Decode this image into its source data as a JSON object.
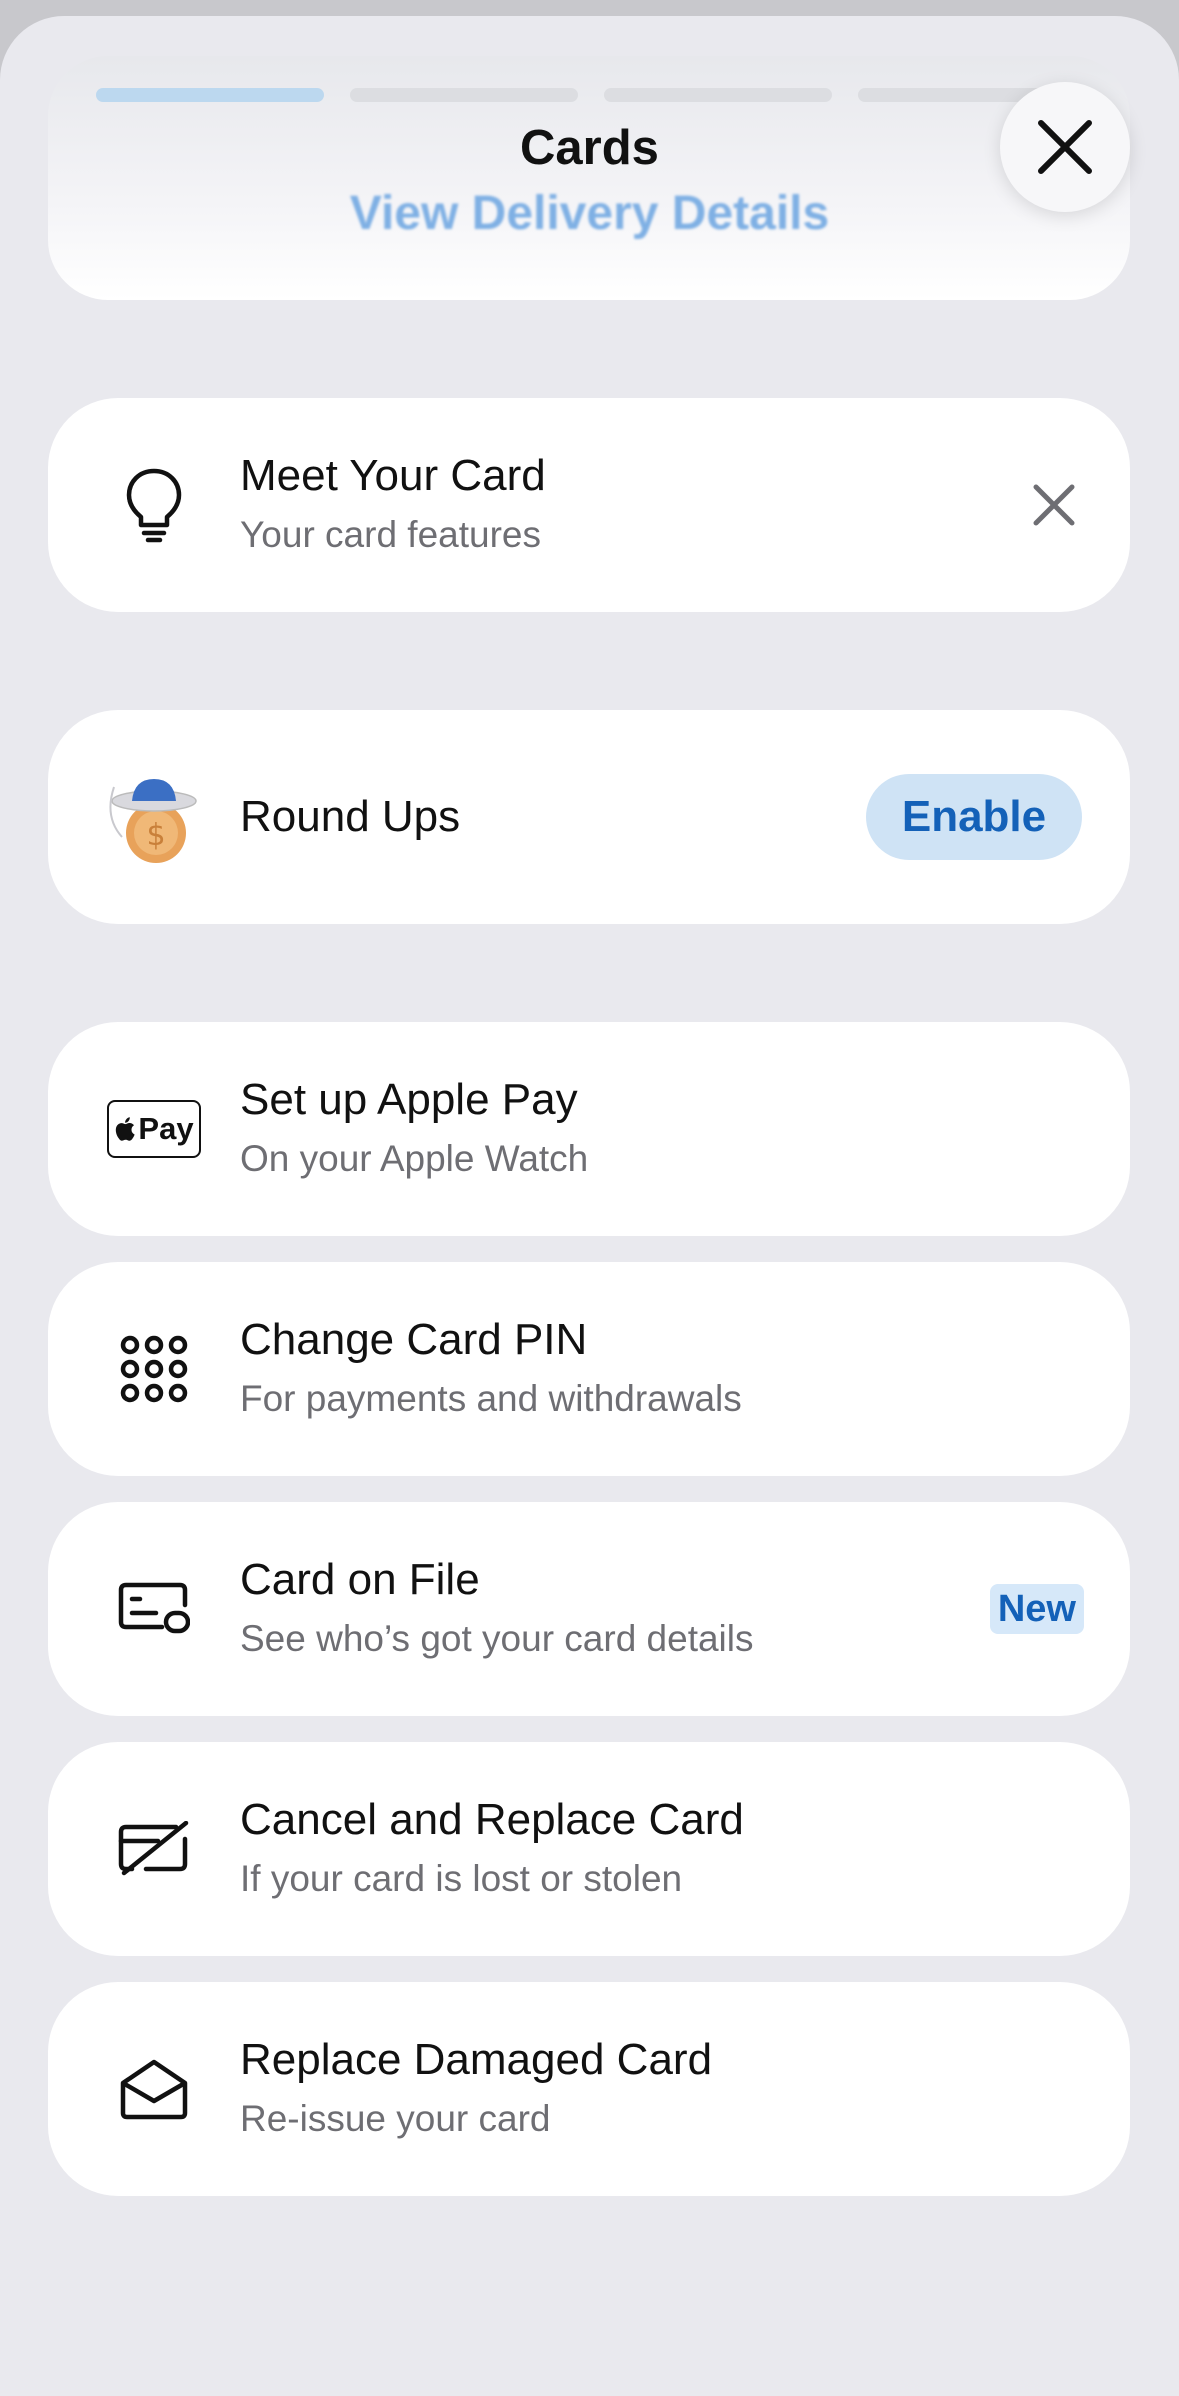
{
  "header": {
    "title": "Cards",
    "subtitle": "View Delivery Details",
    "progress_segments": 4,
    "active_segment": 1,
    "close_icon": "close-icon"
  },
  "items": [
    {
      "title": "Meet Your Card",
      "subtitle": "Your card features",
      "icon": "lightbulb-icon",
      "action": "dismiss-icon"
    },
    {
      "title": "Round Ups",
      "icon": "round-ups-coin-icon",
      "action_label": "Enable"
    },
    {
      "title": "Set up Apple Pay",
      "subtitle": "On your Apple Watch",
      "icon": "apple-pay-icon",
      "icon_text": "Pay"
    },
    {
      "title": "Change Card PIN",
      "subtitle": "For payments and withdrawals",
      "icon": "keypad-icon"
    },
    {
      "title": "Card on File",
      "subtitle": "See who’s got your card details",
      "icon": "card-on-file-icon",
      "badge": "New"
    },
    {
      "title": "Cancel and Replace Card",
      "subtitle": "If your card is lost or stolen",
      "icon": "card-cancelled-icon"
    },
    {
      "title": "Replace Damaged Card",
      "subtitle": "Re-issue your card",
      "icon": "envelope-open-icon"
    }
  ],
  "colors": {
    "accent": "#1461b8",
    "accent_bg": "#cfe3f5",
    "background": "#e9e9ee",
    "card": "#ffffff",
    "secondary_text": "#6e6e73"
  }
}
